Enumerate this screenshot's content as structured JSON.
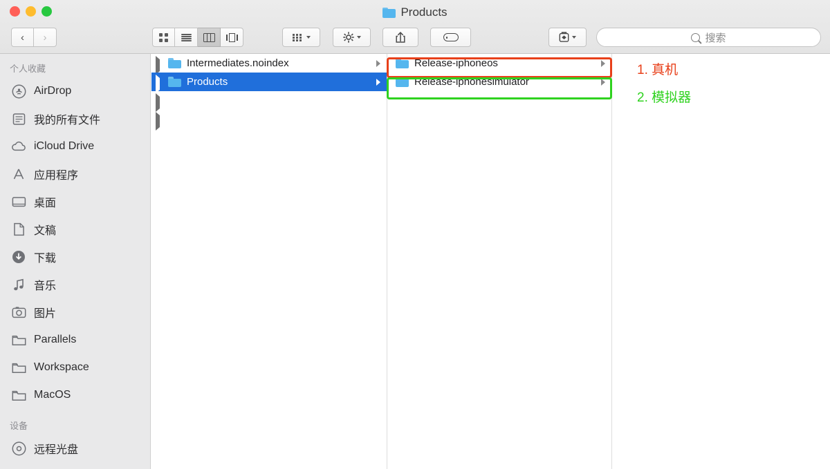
{
  "window": {
    "title": "Products",
    "title_icon": "folder-icon"
  },
  "traffic_lights": {
    "close": "close-button",
    "minimize": "minimize-button",
    "maximize": "maximize-button"
  },
  "toolbar": {
    "back_label": "‹",
    "forward_label": "›",
    "views": [
      {
        "name": "icon-view",
        "icon": "grid-icon",
        "active": false
      },
      {
        "name": "list-view",
        "icon": "list-icon",
        "active": false
      },
      {
        "name": "column-view",
        "icon": "columns-icon",
        "active": true
      },
      {
        "name": "coverflow-view",
        "icon": "coverflow-icon",
        "active": false
      }
    ],
    "arrange_icon": "arrange-icon",
    "action_icon": "gear-icon",
    "share_icon": "share-icon",
    "tag_icon": "tag-icon",
    "dropbox_icon": "dropbox-icon"
  },
  "search": {
    "placeholder": "搜索",
    "value": "",
    "icon": "search-icon"
  },
  "sidebar": {
    "sections": [
      {
        "header": "个人收藏",
        "items": [
          {
            "label": "AirDrop",
            "icon": "airdrop-icon"
          },
          {
            "label": "我的所有文件",
            "icon": "all-files-icon"
          },
          {
            "label": "iCloud Drive",
            "icon": "icloud-icon"
          },
          {
            "label": "应用程序",
            "icon": "applications-icon"
          },
          {
            "label": "桌面",
            "icon": "desktop-icon"
          },
          {
            "label": "文稿",
            "icon": "documents-icon"
          },
          {
            "label": "下载",
            "icon": "downloads-icon"
          },
          {
            "label": "音乐",
            "icon": "music-icon"
          },
          {
            "label": "图片",
            "icon": "pictures-icon"
          },
          {
            "label": "Parallels",
            "icon": "folder-icon"
          },
          {
            "label": "Workspace",
            "icon": "folder-icon"
          },
          {
            "label": "MacOS",
            "icon": "folder-icon"
          }
        ]
      },
      {
        "header": "设备",
        "items": [
          {
            "label": "远程光盘",
            "icon": "remote-disc-icon"
          }
        ]
      }
    ]
  },
  "columns": [
    {
      "name": "column-1",
      "rows": [
        {
          "label": "Intermediates.noindex",
          "disclosure": true,
          "has_arrow": true,
          "selected": false,
          "icon": "folder-icon"
        },
        {
          "label": "Products",
          "disclosure": true,
          "has_arrow": true,
          "selected": true,
          "icon": "folder-icon"
        },
        {
          "label": "",
          "disclosure": true,
          "has_arrow": false,
          "selected": false,
          "icon": ""
        },
        {
          "label": "",
          "disclosure": true,
          "has_arrow": false,
          "selected": false,
          "icon": ""
        }
      ]
    },
    {
      "name": "column-2",
      "rows": [
        {
          "label": "Release-iphoneos",
          "disclosure": false,
          "has_arrow": true,
          "selected": false,
          "icon": "folder-icon"
        },
        {
          "label": "Release-iphonesimulator",
          "disclosure": false,
          "has_arrow": true,
          "selected": false,
          "icon": "folder-icon"
        }
      ]
    },
    {
      "name": "column-3",
      "rows": []
    }
  ],
  "annotations": {
    "device_box_color": "#e8401a",
    "simulator_box_color": "#2fd21f",
    "labels": [
      {
        "text": "1. 真机",
        "color": "#e8401a"
      },
      {
        "text": "2. 模拟器",
        "color": "#2fd21f"
      }
    ]
  }
}
